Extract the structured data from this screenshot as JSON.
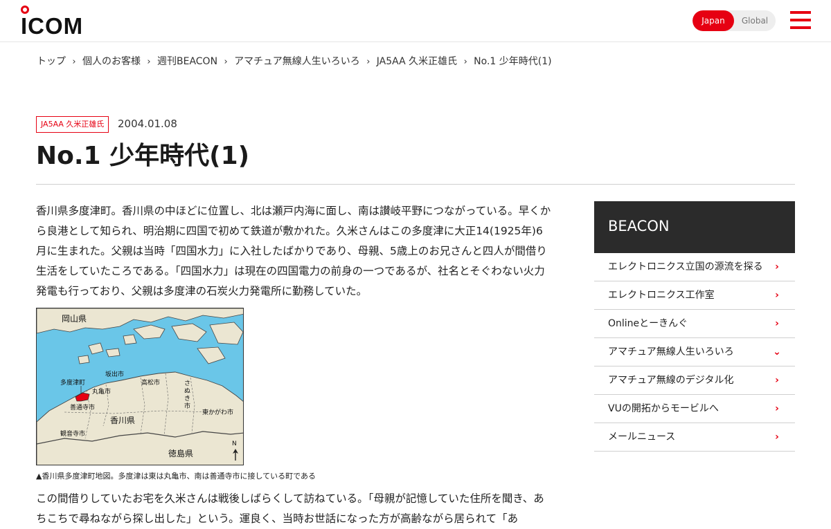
{
  "header": {
    "logo_text": "ICOM",
    "region": {
      "japan": "Japan",
      "global": "Global"
    },
    "accent_color": "#e60012"
  },
  "breadcrumb": [
    "トップ",
    "個人のお客様",
    "週刊BEACON",
    "アマチュア無線人生いろいろ",
    "JA5AA 久米正雄氏",
    "No.1 少年時代(1)"
  ],
  "article": {
    "tag": "JA5AA 久米正雄氏",
    "date": "2004.01.08",
    "title": "No.1 少年時代(1)",
    "paragraph1": "香川県多度津町。香川県の中ほどに位置し、北は瀬戸内海に面し、南は讃岐平野につながっている。早くから良港として知られ、明治期に四国で初めて鉄道が敷かれた。久米さんはこの多度津に大正14(1925年)6月に生まれた。父親は当時「四国水力」に入社したばかりであり、母親、5歳上のお兄さんと四人が間借り生活をしていたころである。「四国水力」は現在の四国電力の前身の一つであるが、社名とそぐわない火力発電も行っており、父親は多度津の石炭火力発電所に勤務していた。",
    "map_caption": "▲香川県多度津町地図。多度津は東は丸亀市、南は善通寺市に接している町である",
    "paragraph2": "この間借りしていたお宅を久米さんは戦後しばらくして訪ねている。「母親が記憶していた住所を聞き、あちこちで尋ねながら探し出した」という。運良く、当時お世話になった方が高齢ながら居られて「あ"
  },
  "map": {
    "labels": {
      "okayama": "岡山県",
      "tadotsu": "多度津町",
      "sakaide": "坂出市",
      "takamatsu": "高松市",
      "sanuki": "さぬき市",
      "marugame": "丸亀市",
      "zentsuji": "善通寺市",
      "kagawa": "香川県",
      "higashikagawa": "東かがわ市",
      "kanonji": "観音寺市",
      "tokushima": "徳島県",
      "north": "N"
    },
    "sea_color": "#6ac6e8",
    "land_color": "#ebe6d2",
    "highlight_color": "#e60012"
  },
  "sidebar": {
    "title": "BEACON",
    "items": [
      {
        "label": "エレクトロニクス立国の源流を探る",
        "arrow": "›"
      },
      {
        "label": "エレクトロニクス工作室",
        "arrow": "›"
      },
      {
        "label": "Onlineとーきんぐ",
        "arrow": "›"
      },
      {
        "label": "アマチュア無線人生いろいろ",
        "arrow": "⌄"
      },
      {
        "label": "アマチュア無線のデジタル化",
        "arrow": "›"
      },
      {
        "label": "VUの開拓からモービルへ",
        "arrow": "›"
      },
      {
        "label": "メールニュース",
        "arrow": "›"
      }
    ]
  }
}
